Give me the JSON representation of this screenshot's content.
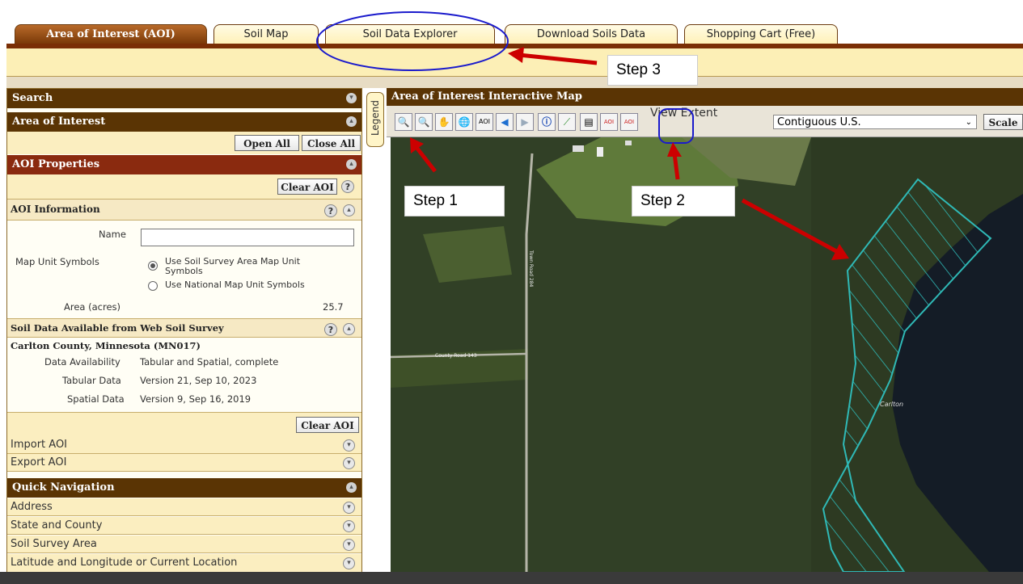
{
  "tabs": [
    {
      "label": "Area of Interest (AOI)",
      "active": true
    },
    {
      "label": "Soil Map",
      "active": false
    },
    {
      "label": "Soil Data Explorer",
      "active": false
    },
    {
      "label": "Download Soils Data",
      "active": false
    },
    {
      "label": "Shopping Cart (Free)",
      "active": false
    }
  ],
  "left_panel": {
    "search_title": "Search",
    "aoi_title": "Area of Interest",
    "open_all": "Open All",
    "close_all": "Close All",
    "aoi_properties_title": "AOI Properties",
    "clear_aoi": "Clear AOI",
    "aoi_information_title": "AOI Information",
    "name_label": "Name",
    "name_value": "",
    "map_unit_symbols_label": "Map Unit Symbols",
    "radio_soil_survey": "Use Soil Survey Area Map Unit Symbols",
    "radio_national": "Use National Map Unit Symbols",
    "area_label": "Area (acres)",
    "area_value": "25.7",
    "soil_data_title": "Soil Data Available from Web Soil Survey",
    "county_title": "Carlton County, Minnesota (MN017)",
    "data_availability_label": "Data Availability",
    "data_availability_value": "Tabular and Spatial, complete",
    "tabular_label": "Tabular Data",
    "tabular_value": "Version 21, Sep 10, 2023",
    "spatial_label": "Spatial Data",
    "spatial_value": "Version 9, Sep 16, 2019",
    "clear_aoi_2": "Clear AOI",
    "import_aoi": "Import AOI",
    "export_aoi": "Export AOI",
    "quick_nav_title": "Quick Navigation",
    "quick_nav_items": [
      "Address",
      "State and County",
      "Soil Survey Area",
      "Latitude and Longitude or Current Location"
    ]
  },
  "legend_label": "Legend",
  "map": {
    "title": "Area of Interest Interactive Map",
    "view_extent_label": "View Extent",
    "view_extent_value": "Contiguous U.S.",
    "scale_label": "Scale",
    "road_label_1": "County Road 143",
    "road_label_2": "Town Road 284",
    "place_label": "Carlton"
  },
  "annotations": {
    "step1": "Step 1",
    "step2": "Step 2",
    "step3": "Step 3",
    "color": "#cc0000",
    "circle_color": "#1a1acc"
  }
}
